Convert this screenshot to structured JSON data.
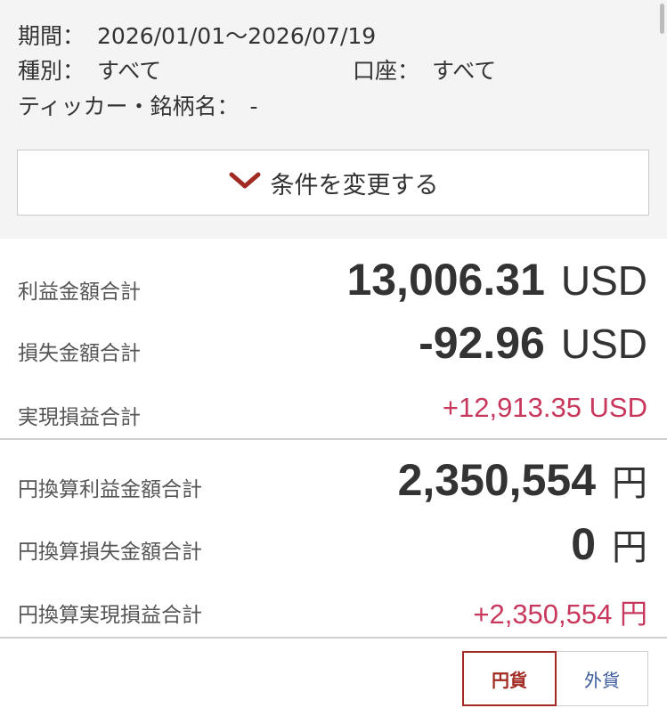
{
  "filters": {
    "period_label": "期間：",
    "period_value": "2026/01/01〜2026/07/19",
    "type_label": "種別：",
    "type_value": "すべて",
    "account_label": "口座：",
    "account_value": "すべて",
    "ticker_label": "ティッカー・銘柄名：",
    "ticker_value": "-",
    "change_button": "条件を変更する"
  },
  "usd_summary": {
    "profit_label": "利益金額合計",
    "profit_value": "13,006.31",
    "profit_unit": "USD",
    "loss_label": "損失金額合計",
    "loss_value": "-92.96",
    "loss_unit": "USD",
    "realized_label": "実現損益合計",
    "realized_value": "+12,913.35 USD"
  },
  "jpy_summary": {
    "profit_label": "円換算利益金額合計",
    "profit_value": "2,350,554",
    "profit_unit": "円",
    "loss_label": "円換算損失金額合計",
    "loss_value": "0",
    "loss_unit": "円",
    "realized_label": "円換算実現損益合計",
    "realized_value": "+2,350,554 円"
  },
  "currency_toggle": {
    "yen_label": "円貨",
    "foreign_label": "外貨",
    "selected": "円貨"
  },
  "colors": {
    "accent": "#a12b22",
    "positive": "#c8385d",
    "link": "#3a5a9c"
  }
}
